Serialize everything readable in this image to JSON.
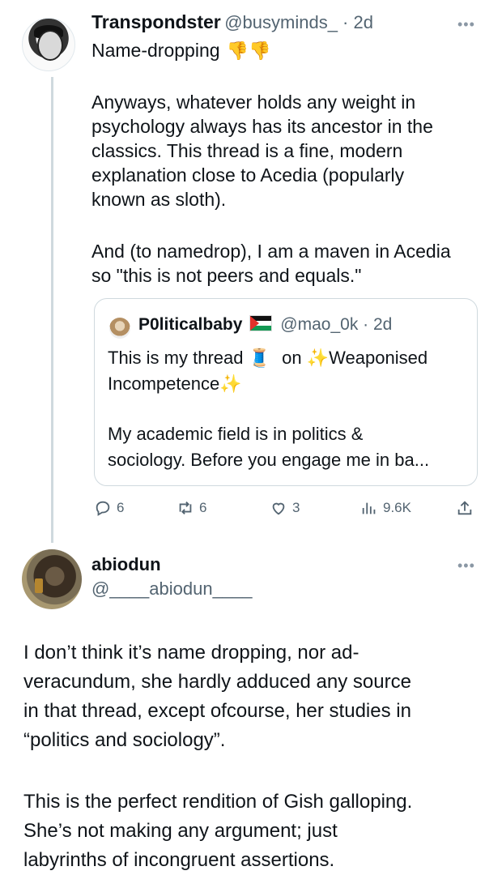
{
  "tweet1": {
    "display_name": "Transpondster",
    "handle_time": "@busyminds_ · 2d",
    "line1": "Name-dropping",
    "emoji": "👎👎",
    "para1": [
      "Anyways, whatever holds any weight in",
      "psychology always has its ancestor in the",
      "classics. This thread is a fine, modern",
      "explanation close to Acedia (popularly",
      "known as sloth)."
    ],
    "para2": [
      "And (to namedrop), I am a maven in Acedia",
      "so \"this is not peers and equals.\""
    ],
    "more": "•••"
  },
  "quote": {
    "display_name": "P0liticalbaby",
    "handle_time": "@mao_0k · 2d",
    "line1a": "This is my thread",
    "thread_emoji": "🧵",
    "line1b": "on",
    "line1c": "Weaponised",
    "sparkle": "✨",
    "line2": "Incompetence",
    "para2": [
      "My academic field is in politics &",
      "sociology. Before you engage me in ba..."
    ]
  },
  "actions": {
    "replies": "6",
    "retweets": "6",
    "likes": "3",
    "views": "9.6K"
  },
  "tweet2": {
    "display_name": "abiodun",
    "handle": "@____abiodun____",
    "more": "•••",
    "para1": [
      "I don’t think it’s name dropping, nor ad-",
      "veracundum, she hardly adduced any source",
      "in that thread, except ofcourse, her studies in",
      "“politics and sociology”."
    ],
    "para2": [
      "This is the perfect rendition of Gish galloping.",
      "She’s not making any argument; just",
      "labyrinths of incongruent assertions."
    ]
  },
  "colors": {
    "muted": "#536471",
    "border": "#cfd9de",
    "text": "#0f1419"
  }
}
